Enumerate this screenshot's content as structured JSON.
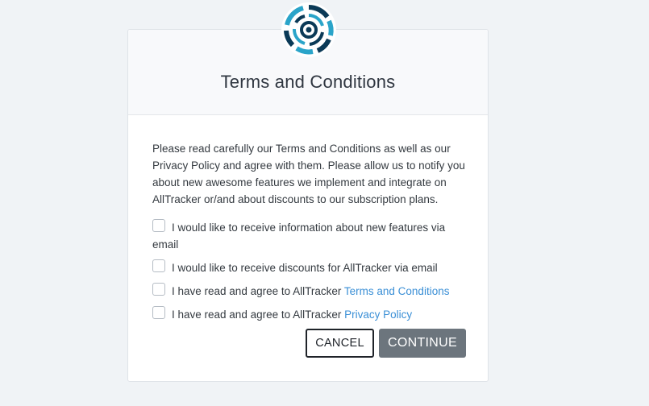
{
  "header": {
    "title": "Terms and Conditions"
  },
  "intro_text": "Please read carefully our Terms and Conditions as well as our Privacy Policy and agree with them. Please allow us to notify you about new awesome features we implement and integrate on AllTracker or/and about discounts to our subscription plans.",
  "options": [
    {
      "label": "I would like to receive information about new features via email",
      "checked": false
    },
    {
      "label": "I would like to receive discounts for AllTracker via email",
      "checked": false
    },
    {
      "label_prefix": "I have read and agree to AllTracker ",
      "link_text": "Terms and Conditions",
      "checked": false
    },
    {
      "label_prefix": "I have read and agree to AllTracker ",
      "link_text": "Privacy Policy",
      "checked": false
    }
  ],
  "buttons": {
    "cancel_label": "CANCEL",
    "continue_label": "CONTINUE"
  },
  "colors": {
    "page_background": "#f0f3f6",
    "link": "#3a8fd6",
    "continue_button": "#6c757d",
    "logo_dark": "#0b3a57",
    "logo_light": "#2aa4c9"
  },
  "icons": {
    "logo": "alltracker-logo"
  }
}
